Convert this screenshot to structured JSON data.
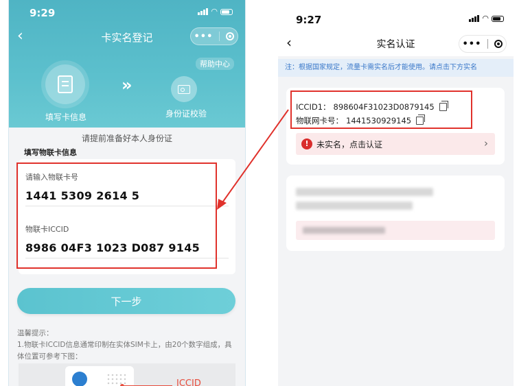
{
  "left_phone": {
    "status": {
      "time": "9:29"
    },
    "nav": {
      "title": "卡实名登记",
      "more_dots": "•••"
    },
    "help_link": "帮助中心",
    "steps": [
      {
        "label": "填写卡信息"
      },
      {
        "label": "身份证校验"
      }
    ],
    "step_arrow": "»",
    "prepare_hint": "请提前准备好本人身份证",
    "section_title": "填写物联卡信息",
    "fields": [
      {
        "label": "请输入物联卡号",
        "value": "1441 5309 2614 5"
      },
      {
        "label": "物联卡ICCID",
        "value": "8986 04F3 1023 D087 9145"
      }
    ],
    "next_button": "下一步",
    "tips": {
      "title": "温馨提示：",
      "body": "1.物联卡ICCID信息通常印制在实体SIM卡上，由20个数字组成，具体位置可参考下图："
    },
    "sim_label": "ICCID"
  },
  "right_phone": {
    "status": {
      "time": "9:27"
    },
    "nav": {
      "title": "实名认证",
      "more_dots": "•••"
    },
    "notice": "注：根据国家规定，流量卡需实名后才能使用。请点击下方实名",
    "info": {
      "iccid_label": "ICCID1：",
      "iccid_value": "898604F31023D0879145",
      "card_label": "物联网卡号：",
      "card_value": "1441530929145"
    },
    "unverified": {
      "icon": "!",
      "text": "未实名，点击认证",
      "chevron": "›"
    }
  },
  "colors": {
    "teal": "#5bc3cf",
    "annotation_red": "#e0312b",
    "notice_blue": "#3a78c9",
    "warning_red": "#d92d2d"
  }
}
